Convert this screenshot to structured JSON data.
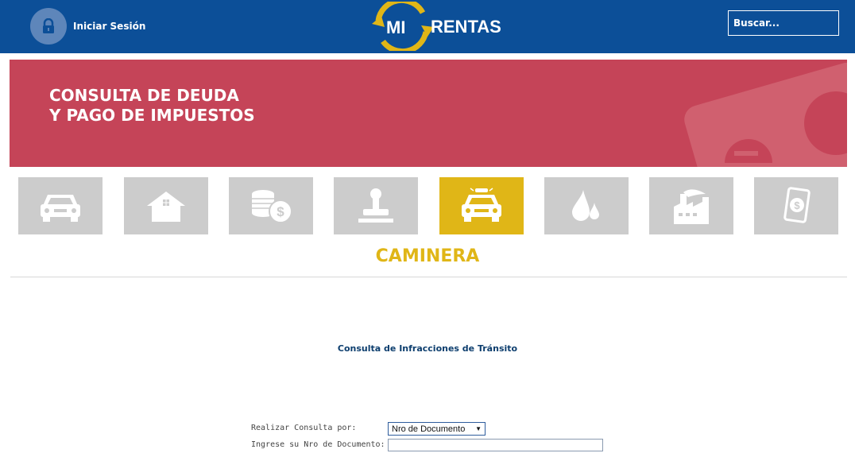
{
  "header": {
    "login_label": "Iniciar Sesión",
    "logo_left": "MI",
    "logo_right": "RENTAS",
    "search_placeholder": "Buscar..."
  },
  "banner": {
    "title_line1": "CONSULTA DE DEUDA",
    "title_line2": "Y PAGO DE IMPUESTOS",
    "background": "#c54458"
  },
  "categories": [
    {
      "icon": "car-icon",
      "active": false
    },
    {
      "icon": "house-icon",
      "active": false
    },
    {
      "icon": "coins-icon",
      "active": false
    },
    {
      "icon": "stamp-icon",
      "active": false
    },
    {
      "icon": "police-car-icon",
      "active": true
    },
    {
      "icon": "water-drop-icon",
      "active": false
    },
    {
      "icon": "factory-icon",
      "active": false
    },
    {
      "icon": "document-dollar-icon",
      "active": false
    }
  ],
  "section_title": "CAMINERA",
  "form": {
    "title": "Consulta de Infracciones de Tránsito",
    "query_by_label": "Realizar Consulta por:",
    "query_by_value": "Nro de Documento",
    "doc_label": "Ingrese su Nro de Documento:",
    "doc_value": ""
  },
  "colors": {
    "header": "#0c4f98",
    "accent": "#e0b617",
    "tile": "#cccccc"
  }
}
